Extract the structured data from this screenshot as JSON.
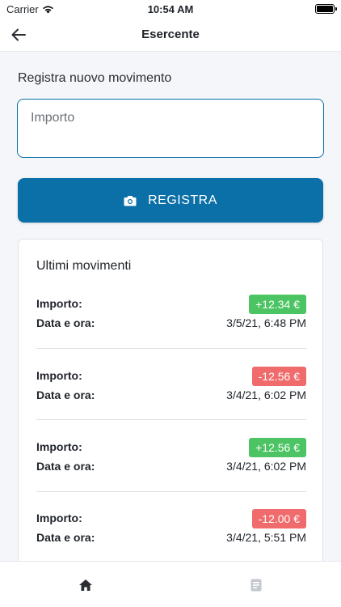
{
  "status_bar": {
    "carrier": "Carrier",
    "time": "10:54 AM"
  },
  "nav": {
    "title": "Esercente"
  },
  "form": {
    "section_label": "Registra nuovo movimento",
    "amount_placeholder": "Importo",
    "register_label": "REGISTRA"
  },
  "recent": {
    "title": "Ultimi movimenti",
    "amount_label": "Importo:",
    "date_label": "Data e ora:",
    "transactions": [
      {
        "amount": "+12.34 €",
        "datetime": "3/5/21, 6:48 PM",
        "type": "credit"
      },
      {
        "amount": "-12.56 €",
        "datetime": "3/4/21, 6:02 PM",
        "type": "debit"
      },
      {
        "amount": "+12.56 €",
        "datetime": "3/4/21, 6:02 PM",
        "type": "credit"
      },
      {
        "amount": "-12.00 €",
        "datetime": "3/4/21, 5:51 PM",
        "type": "debit"
      }
    ]
  },
  "tabs": [
    {
      "name": "home-icon",
      "active": true
    },
    {
      "name": "receipt-icon",
      "active": false
    }
  ],
  "colors": {
    "primary": "#0b6fa8",
    "credit": "#4cc464",
    "debit": "#f06b6b",
    "tab_active": "#2a2e33",
    "tab_inactive": "#c4c8cd"
  }
}
